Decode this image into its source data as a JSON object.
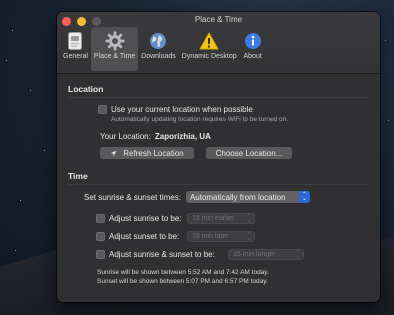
{
  "window": {
    "title": "Place & Time"
  },
  "toolbar": {
    "items": [
      {
        "label": "General",
        "icon": "general-icon",
        "selected": false
      },
      {
        "label": "Place & Time",
        "icon": "gear-icon",
        "selected": true
      },
      {
        "label": "Downloads",
        "icon": "globe-icon",
        "selected": false
      },
      {
        "label": "Dynamic Desktop",
        "icon": "warning-icon",
        "selected": false
      },
      {
        "label": "About",
        "icon": "info-icon",
        "selected": false
      }
    ]
  },
  "location": {
    "section_title": "Location",
    "use_current_label": "Use your current location when possible",
    "use_current_subtext": "Automatically updating location requires WiFi to be turned on.",
    "your_location_label": "Your Location:",
    "your_location_value": "Zaporizhia, UA",
    "refresh_button": "Refresh Location",
    "choose_button": "Choose Location..."
  },
  "time": {
    "section_title": "Time",
    "sunrise_sunset_label": "Set sunrise & sunset times:",
    "sunrise_sunset_value": "Automatically from location",
    "adjust_sunrise_label": "Adjust sunrise to be:",
    "adjust_sunrise_value": "15 min earlier",
    "adjust_sunset_label": "Adjust sunset to be:",
    "adjust_sunset_value": "15 min later",
    "adjust_both_label": "Adjust sunrise & sunset to be:",
    "adjust_both_value": "15 min longer",
    "summary_sunrise": "Sunrise will be shown between 5:52 AM and 7:42 AM today.",
    "summary_sunset": "Sunset will be shown between 5:07 PM and 6:57 PM today."
  },
  "colors": {
    "accent": "#2b67d6",
    "window_bg": "#303032",
    "close": "#fe5f57",
    "minimize": "#febc2e"
  }
}
